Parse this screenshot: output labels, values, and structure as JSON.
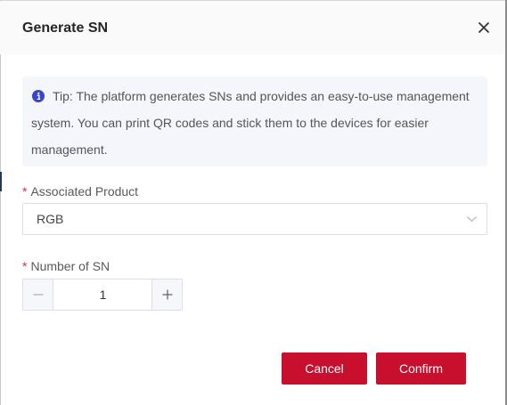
{
  "dialog": {
    "title": "Generate SN",
    "close_icon": "close-icon"
  },
  "tip": {
    "icon": "info-icon",
    "text": "Tip: The platform generates SNs and provides an easy-to-use management system. You can print QR codes and stick them to the devices for easier management."
  },
  "form": {
    "required_mark": "*",
    "product": {
      "label": "Associated Product",
      "value": "RGB",
      "icon": "chevron-down-icon"
    },
    "sn_count": {
      "label": "Number of SN",
      "value": "1",
      "minus_icon": "minus-icon",
      "plus_icon": "plus-icon"
    }
  },
  "actions": {
    "cancel_label": "Cancel",
    "confirm_label": "Confirm"
  },
  "colors": {
    "primary": "#c8102e",
    "required": "#e0303d",
    "info": "#3b46c4",
    "tip_background": "#f5f6fb"
  }
}
